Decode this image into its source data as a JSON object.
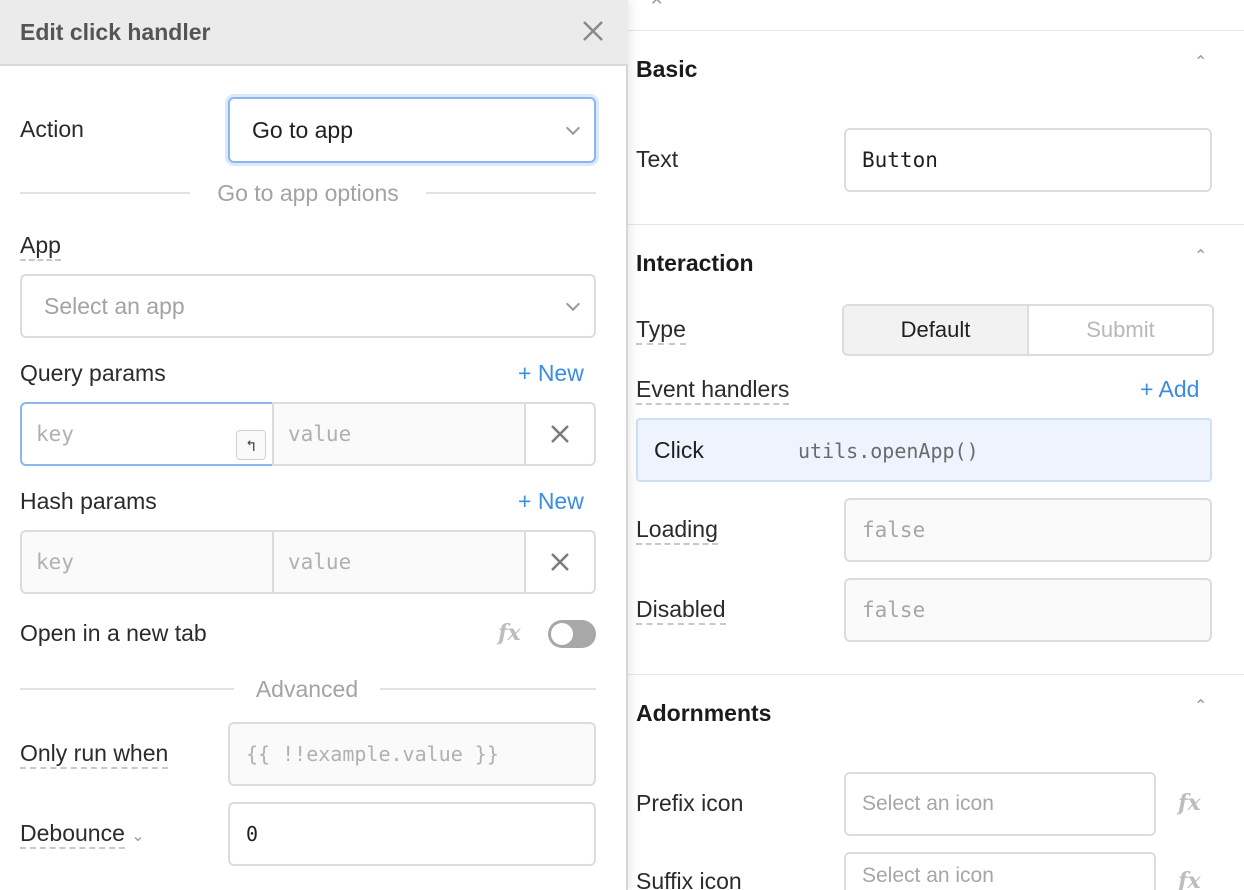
{
  "modal": {
    "title": "Edit click handler",
    "action": {
      "label": "Action",
      "value": "Go to app"
    },
    "options_divider": "Go to app options",
    "app": {
      "label": "App",
      "placeholder": "Select an app"
    },
    "query_params": {
      "label": "Query params",
      "new_label": "+ New",
      "key_placeholder": "key",
      "value_placeholder": "value"
    },
    "hash_params": {
      "label": "Hash params",
      "new_label": "+ New",
      "key_placeholder": "key",
      "value_placeholder": "value"
    },
    "open_new_tab": {
      "label": "Open in a new tab",
      "fx": "fx",
      "enabled": false
    },
    "advanced_divider": "Advanced",
    "only_run_when": {
      "label": "Only run when",
      "placeholder": "{{ !!example.value }}"
    },
    "debounce": {
      "label": "Debounce",
      "value": "0"
    }
  },
  "inspector": {
    "basic": {
      "title": "Basic",
      "text": {
        "label": "Text",
        "value": "Button"
      }
    },
    "interaction": {
      "title": "Interaction",
      "type": {
        "label": "Type",
        "options": [
          "Default",
          "Submit"
        ],
        "selected": "Default"
      },
      "event_handlers": {
        "label": "Event handlers",
        "add_label": "+ Add"
      },
      "handler": {
        "event": "Click",
        "code": "utils.openApp()"
      },
      "loading": {
        "label": "Loading",
        "value": "false"
      },
      "disabled": {
        "label": "Disabled",
        "value": "false"
      }
    },
    "adornments": {
      "title": "Adornments",
      "prefix_icon": {
        "label": "Prefix icon",
        "placeholder": "Select an icon",
        "fx": "fx"
      },
      "suffix_icon": {
        "label": "Suffix icon",
        "placeholder": "Select an icon",
        "fx": "fx"
      }
    }
  },
  "colors": {
    "accent": "#3a8de3",
    "selected_border": "#8ab8ee",
    "handler_bg": "#edf4fd"
  }
}
